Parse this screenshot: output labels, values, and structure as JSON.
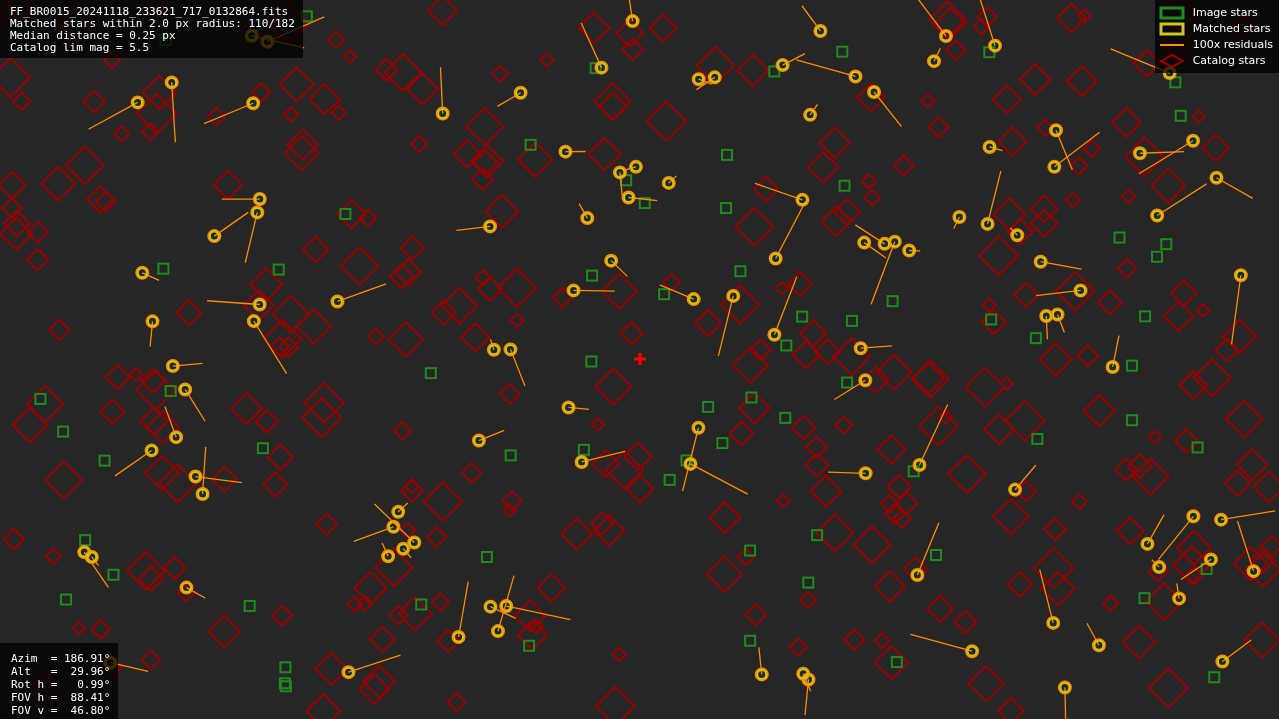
{
  "info": [
    "FF_BR0015_20241118_233621_717_0132864.fits",
    "Matched stars within 2.0 px radius: 110/182",
    "Median distance = 0.25 px",
    "Catalog lim mag = 5.5"
  ],
  "legend": [
    {
      "label": "Image stars",
      "kind": "box",
      "color": "#1e8c1e"
    },
    {
      "label": "Matched stars",
      "kind": "box",
      "color": "#c8c81e"
    },
    {
      "label": "100x residuals",
      "kind": "line",
      "color": "#ff8c00"
    },
    {
      "label": "Catalog stars",
      "kind": "diamond",
      "color": "#9a0000"
    }
  ],
  "pointing": [
    "Azim  = 186.91°",
    "Alt   =  29.96°",
    "Rot h =   0.99°",
    "FOV h =  88.41°",
    "FOV v =  46.80°"
  ]
}
